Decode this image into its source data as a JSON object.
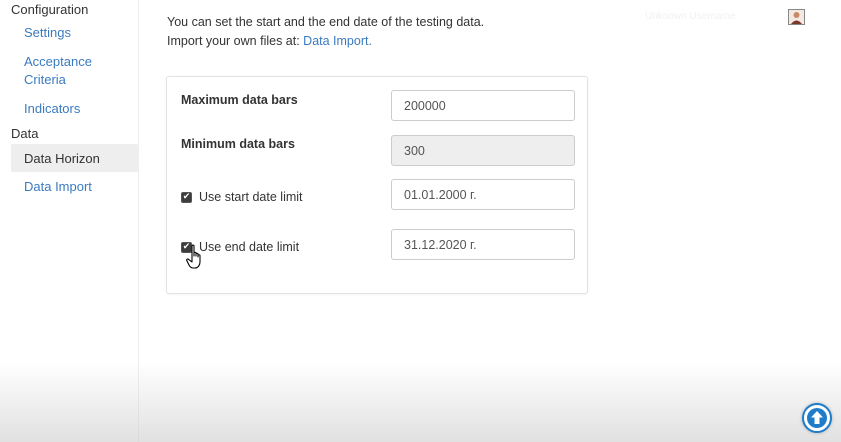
{
  "sidebar": {
    "configuration_heading": "Configuration",
    "settings": "Settings",
    "acceptance_line1": "Acceptance",
    "acceptance_line2": "Criteria",
    "indicators": "Indicators",
    "data_heading": "Data",
    "data_horizon": "Data Horizon",
    "data_import": "Data Import"
  },
  "intro": {
    "line1": "You can set the start and the end date of the testing data.",
    "line2_prefix": "Import your own files at: ",
    "line2_link": "Data Import."
  },
  "form": {
    "max_bars_label": "Maximum data bars",
    "max_bars_value": "200000",
    "min_bars_label": "Minimum data bars",
    "min_bars_value": "300",
    "start_limit_label": "Use start date limit",
    "start_limit_checked": true,
    "start_date_value": "01.01.2000 г.",
    "end_limit_label": "Use end date limit",
    "end_limit_checked": true,
    "end_date_value": "31.12.2020 г."
  },
  "header": {
    "faded_user_text": "Unknown Username"
  },
  "icons": {
    "avatar": "user-avatar-icon",
    "scroll_top": "arrow-up-circle-icon",
    "cursor": "hand-pointer-icon",
    "checkbox": "checkbox-checked-icon"
  },
  "colors": {
    "link": "#3a7bc0",
    "scroll_top_button": "#1e7cc8",
    "active_sidebar": "#eeeeee"
  }
}
